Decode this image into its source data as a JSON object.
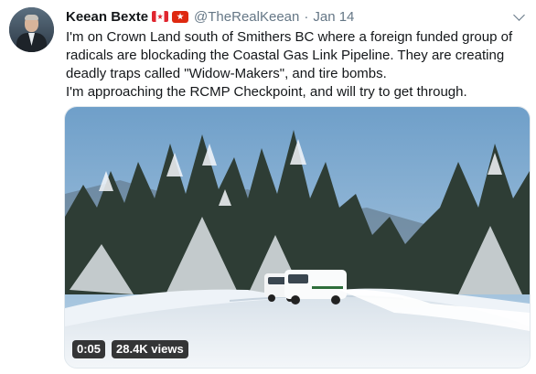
{
  "tweet": {
    "author_name": "Keean Bexte",
    "handle": "@TheRealKeean",
    "separator": "·",
    "date": "Jan 14",
    "flags": [
      "canada-flag-icon",
      "hong-kong-flag-icon"
    ],
    "lines": [
      "I'm on Crown Land south of Smithers BC where a foreign funded group of",
      "radicals are blockading the Coastal Gas Link Pipeline. They are creating",
      "deadly traps called \"Widow-Makers\", and tire bombs.",
      "I'm approaching the RCMP Checkpoint, and will try to get through."
    ]
  },
  "video": {
    "duration": "0:05",
    "views": "28.4K views"
  },
  "colors": {
    "text": "#14171a",
    "secondary": "#657786",
    "sky": "#8fb6d6",
    "snow": "#eef3f8"
  }
}
